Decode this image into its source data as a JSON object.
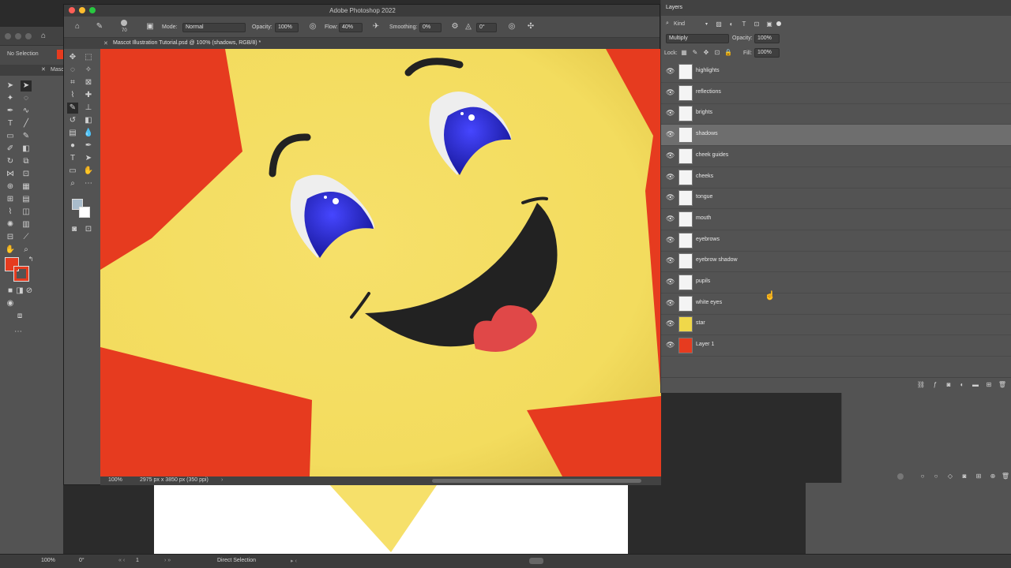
{
  "ai": {
    "no_selection": "No Selection",
    "tab_label": "Masc",
    "zoom": "100%",
    "angle": "0°",
    "page": "1",
    "tool_name": "Direct Selection"
  },
  "ps": {
    "title": "Adobe Photoshop 2022",
    "brush_size": "70",
    "mode_label": "Mode:",
    "mode_value": "Normal",
    "opacity_label": "Opacity:",
    "opacity_value": "100%",
    "flow_label": "Flow:",
    "flow_value": "40%",
    "smoothing_label": "Smoothing:",
    "smoothing_value": "0%",
    "angle_value": "0°",
    "doc_tab": "Mascot Illustration Tutorial.psd @ 100% (shadows, RGB/8) *",
    "status_zoom": "100%",
    "status_doc": "2975 px x 3850 px (350 ppi)"
  },
  "layers": {
    "panel_title": "Layers",
    "kind_label": "Kind",
    "blend_mode": "Multiply",
    "opacity_label": "Opacity:",
    "opacity_value": "100%",
    "lock_label": "Lock:",
    "fill_label": "Fill:",
    "fill_value": "100%",
    "items": [
      {
        "name": "highlights",
        "thumb": "#f4f4f4"
      },
      {
        "name": "reflections",
        "thumb": "#f4f4f4"
      },
      {
        "name": "brights",
        "thumb": "#f4f4f4"
      },
      {
        "name": "shadows",
        "thumb": "#f4f4f4"
      },
      {
        "name": "cheek guides",
        "thumb": "#f4f4f4"
      },
      {
        "name": "cheeks",
        "thumb": "#f4f4f4"
      },
      {
        "name": "tongue",
        "thumb": "#f4f4f4"
      },
      {
        "name": "mouth",
        "thumb": "#f4f4f4"
      },
      {
        "name": "eyebrows",
        "thumb": "#f4f4f4"
      },
      {
        "name": "eyebrow shadow",
        "thumb": "#f4f4f4"
      },
      {
        "name": "pupils",
        "thumb": "#f4f4f4"
      },
      {
        "name": "white eyes",
        "thumb": "#f4f4f4"
      },
      {
        "name": "star",
        "thumb": "#f0d84a"
      },
      {
        "name": "Layer 1",
        "thumb": "#e63b1f"
      }
    ],
    "selected": "shadows"
  },
  "colors": {
    "canvas_bg": "#e63b1f",
    "star": "#f6e06a",
    "pupil": "#1a1ab8",
    "mouth": "#222222",
    "tongue": "#e04848"
  }
}
